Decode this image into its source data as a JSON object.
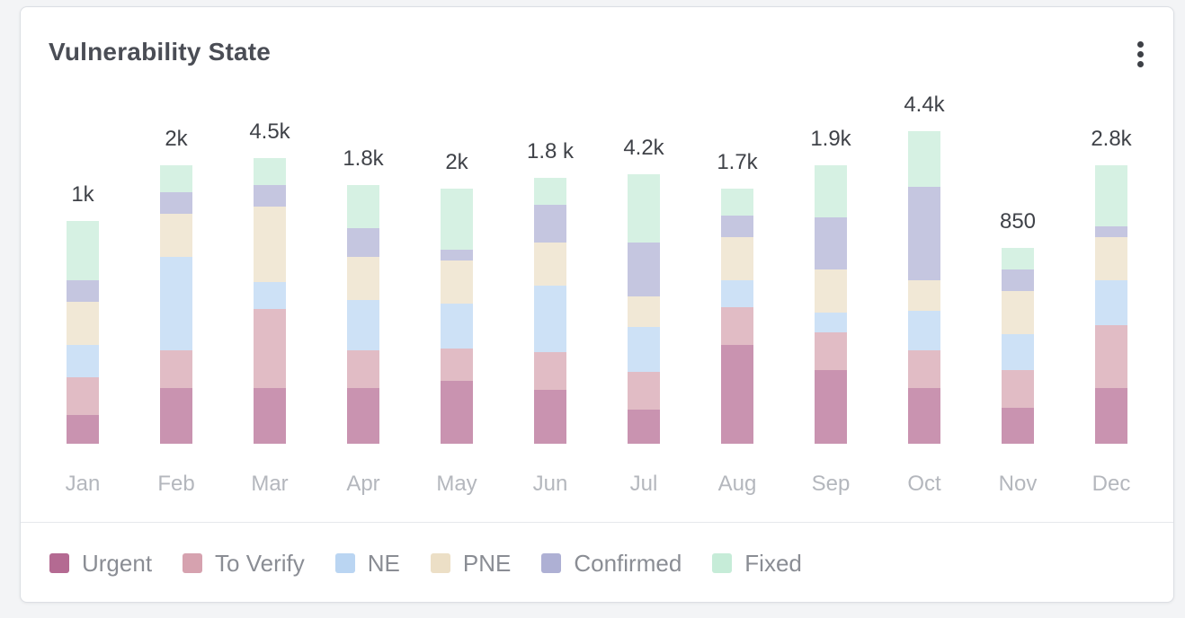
{
  "header": {
    "title": "Vulnerability State",
    "menu_icon": "more-vertical-icon"
  },
  "chart_data": {
    "type": "bar",
    "stacked": true,
    "title": "Vulnerability State",
    "categories": [
      "Jan",
      "Feb",
      "Mar",
      "Apr",
      "May",
      "Jun",
      "Jul",
      "Aug",
      "Sep",
      "Oct",
      "Nov",
      "Dec"
    ],
    "totals_labels": [
      "1k",
      "2k",
      "4.5k",
      "1.8k",
      "2k",
      "1.8 k",
      "4.2k",
      "1.7k",
      "1.9k",
      "4.4k",
      "850",
      "2.8k"
    ],
    "series": [
      {
        "name": "Urgent",
        "color": "#b46a92",
        "values": [
          16,
          31,
          31,
          31,
          35,
          30,
          19,
          55,
          41,
          31,
          20,
          31
        ]
      },
      {
        "name": "To Verify",
        "color": "#d6a2af",
        "values": [
          21,
          21,
          44,
          21,
          18,
          21,
          21,
          21,
          21,
          21,
          21,
          35
        ]
      },
      {
        "name": "NE",
        "color": "#bad5f2",
        "values": [
          18,
          52,
          15,
          28,
          25,
          37,
          25,
          15,
          11,
          22,
          20,
          25
        ]
      },
      {
        "name": "PNE",
        "color": "#ecdfc6",
        "values": [
          24,
          24,
          42,
          24,
          24,
          24,
          17,
          24,
          24,
          17,
          24,
          24
        ]
      },
      {
        "name": "Confirmed",
        "color": "#aeb0d4",
        "values": [
          12,
          12,
          12,
          16,
          6,
          21,
          30,
          12,
          29,
          52,
          12,
          6
        ]
      },
      {
        "name": "Fixed",
        "color": "#c6ecd8",
        "values": [
          33,
          15,
          15,
          24,
          34,
          15,
          38,
          15,
          29,
          31,
          12,
          34
        ]
      }
    ],
    "legend_position": "bottom-left",
    "grid": false
  },
  "legend": {
    "items": [
      {
        "label": "Urgent",
        "color": "#b46a92"
      },
      {
        "label": "To Verify",
        "color": "#d6a2af"
      },
      {
        "label": "NE",
        "color": "#bad5f2"
      },
      {
        "label": "PNE",
        "color": "#ecdfc6"
      },
      {
        "label": "Confirmed",
        "color": "#aeb0d4"
      },
      {
        "label": "Fixed",
        "color": "#c6ecd8"
      }
    ]
  }
}
